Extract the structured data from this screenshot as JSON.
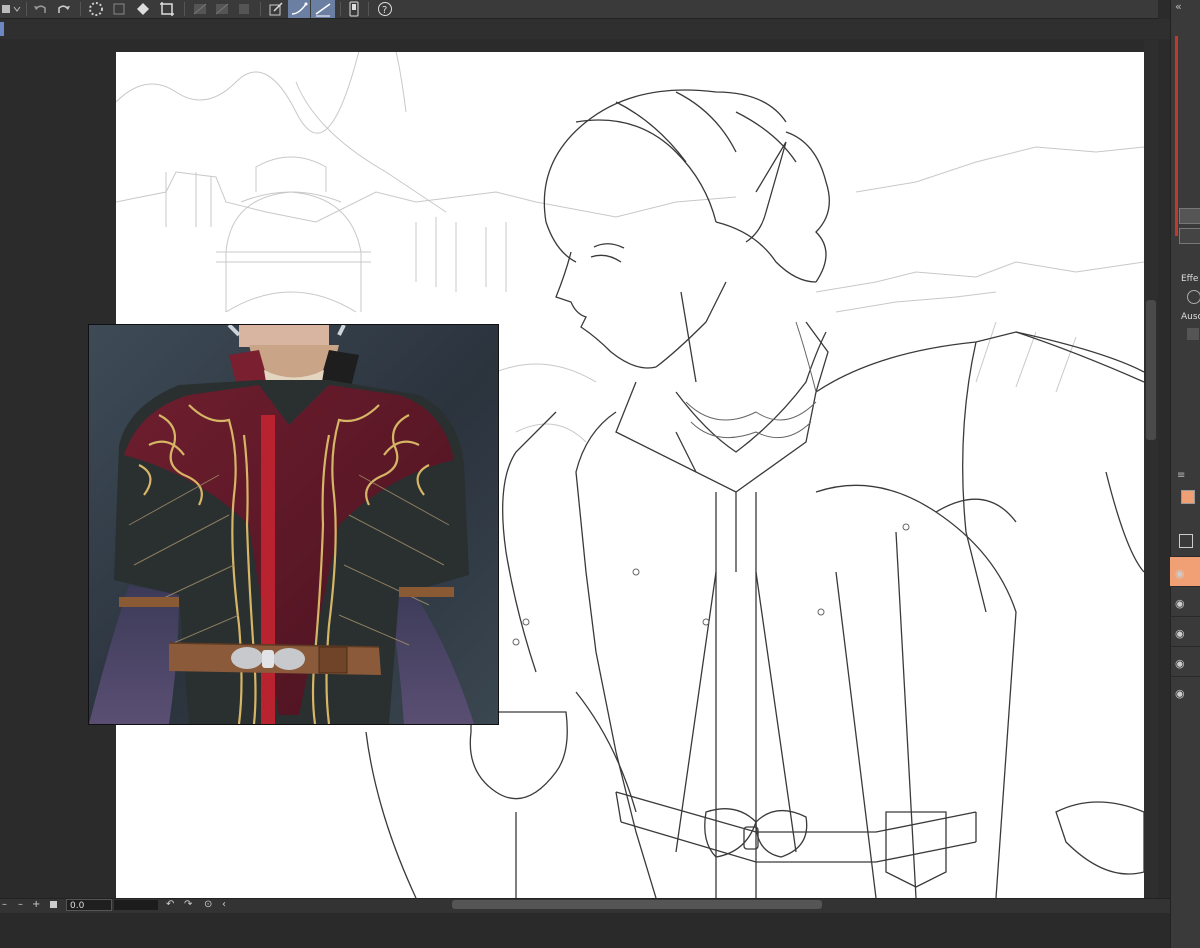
{
  "toolbar": {
    "icons": [
      "brush-dropdown-icon",
      "undo-icon",
      "redo-icon",
      "loading-icon",
      "transform-icon",
      "fill-icon",
      "crop-icon",
      "ruler-off-icon",
      "ruler-snap-icon",
      "snap-icon",
      "edit-line-icon",
      "curve-snap-icon",
      "line-snap-icon",
      "device-icon",
      "help-icon"
    ],
    "active": [
      "curve-snap-icon",
      "line-snap-icon"
    ]
  },
  "status_bar": {
    "zoom_value": "0.0"
  },
  "right_panel": {
    "effect_label": "Effe",
    "output_label": "Ausc",
    "layer_color": "#f0a074"
  },
  "colors": {
    "accent": "#6b7fa3",
    "layer_active": "#f0a074",
    "canvas": "#ffffff"
  }
}
